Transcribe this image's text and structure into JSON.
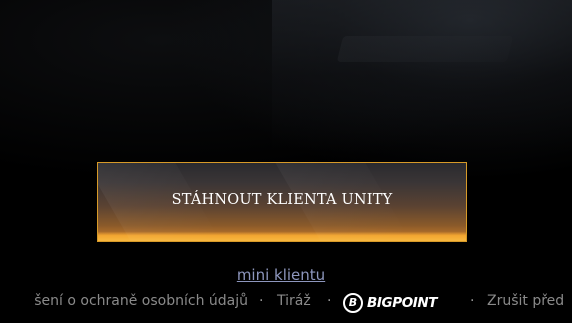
{
  "download": {
    "label": "STÁHNOUT KLIENTA UNITY"
  },
  "mini_client": {
    "label": "mini klientu"
  },
  "footer": {
    "privacy_label": "šení o ochraně osobních údajů",
    "separator": "·",
    "imprint_label": "Tiráž",
    "brand": "BIGPOINT",
    "unsubscribe_label": "Zrušit před"
  },
  "colors": {
    "button_border": "#d79a28",
    "button_glow": "#f2a631",
    "link": "#8d96bd",
    "footer_text": "#8a8a8a"
  }
}
